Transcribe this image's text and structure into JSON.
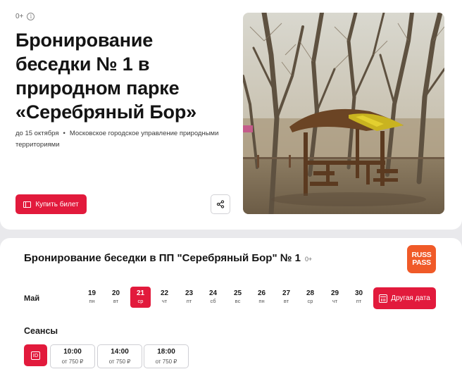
{
  "event": {
    "age_rating": "0+",
    "title": "Бронирование беседки № 1 в природном парке «Серебряный Бор»",
    "date_range": "до 15 октября",
    "separator": "•",
    "organizer": "Московское управление природными территориями",
    "organizer_full": "Московское городское управление природными территориями",
    "buy_label": "Купить билет"
  },
  "booking": {
    "title": "Бронирование беседки в ПП \"Серебряный Бор\" № 1",
    "age_rating": "0+",
    "brand_line1": "RUSS",
    "brand_line2": "PASS",
    "month": "Май",
    "days": [
      {
        "num": "19",
        "wd": "пн",
        "selected": false
      },
      {
        "num": "20",
        "wd": "вт",
        "selected": false
      },
      {
        "num": "21",
        "wd": "ср",
        "selected": true
      },
      {
        "num": "22",
        "wd": "чт",
        "selected": false
      },
      {
        "num": "23",
        "wd": "пт",
        "selected": false
      },
      {
        "num": "24",
        "wd": "сб",
        "selected": false
      },
      {
        "num": "25",
        "wd": "вс",
        "selected": false
      },
      {
        "num": "26",
        "wd": "пн",
        "selected": false
      },
      {
        "num": "27",
        "wd": "вт",
        "selected": false
      },
      {
        "num": "28",
        "wd": "ср",
        "selected": false
      },
      {
        "num": "29",
        "wd": "чт",
        "selected": false
      },
      {
        "num": "30",
        "wd": "пт",
        "selected": false
      }
    ],
    "other_date_label": "Другая дата",
    "sessions_title": "Сеансы",
    "id_label": "ID",
    "sessions": [
      {
        "time": "10:00",
        "price": "от 750 ₽"
      },
      {
        "time": "14:00",
        "price": "от 750 ₽"
      },
      {
        "time": "18:00",
        "price": "от 750 ₽"
      }
    ]
  },
  "colors": {
    "accent": "#e21a3c",
    "brand": "#f05a28"
  }
}
